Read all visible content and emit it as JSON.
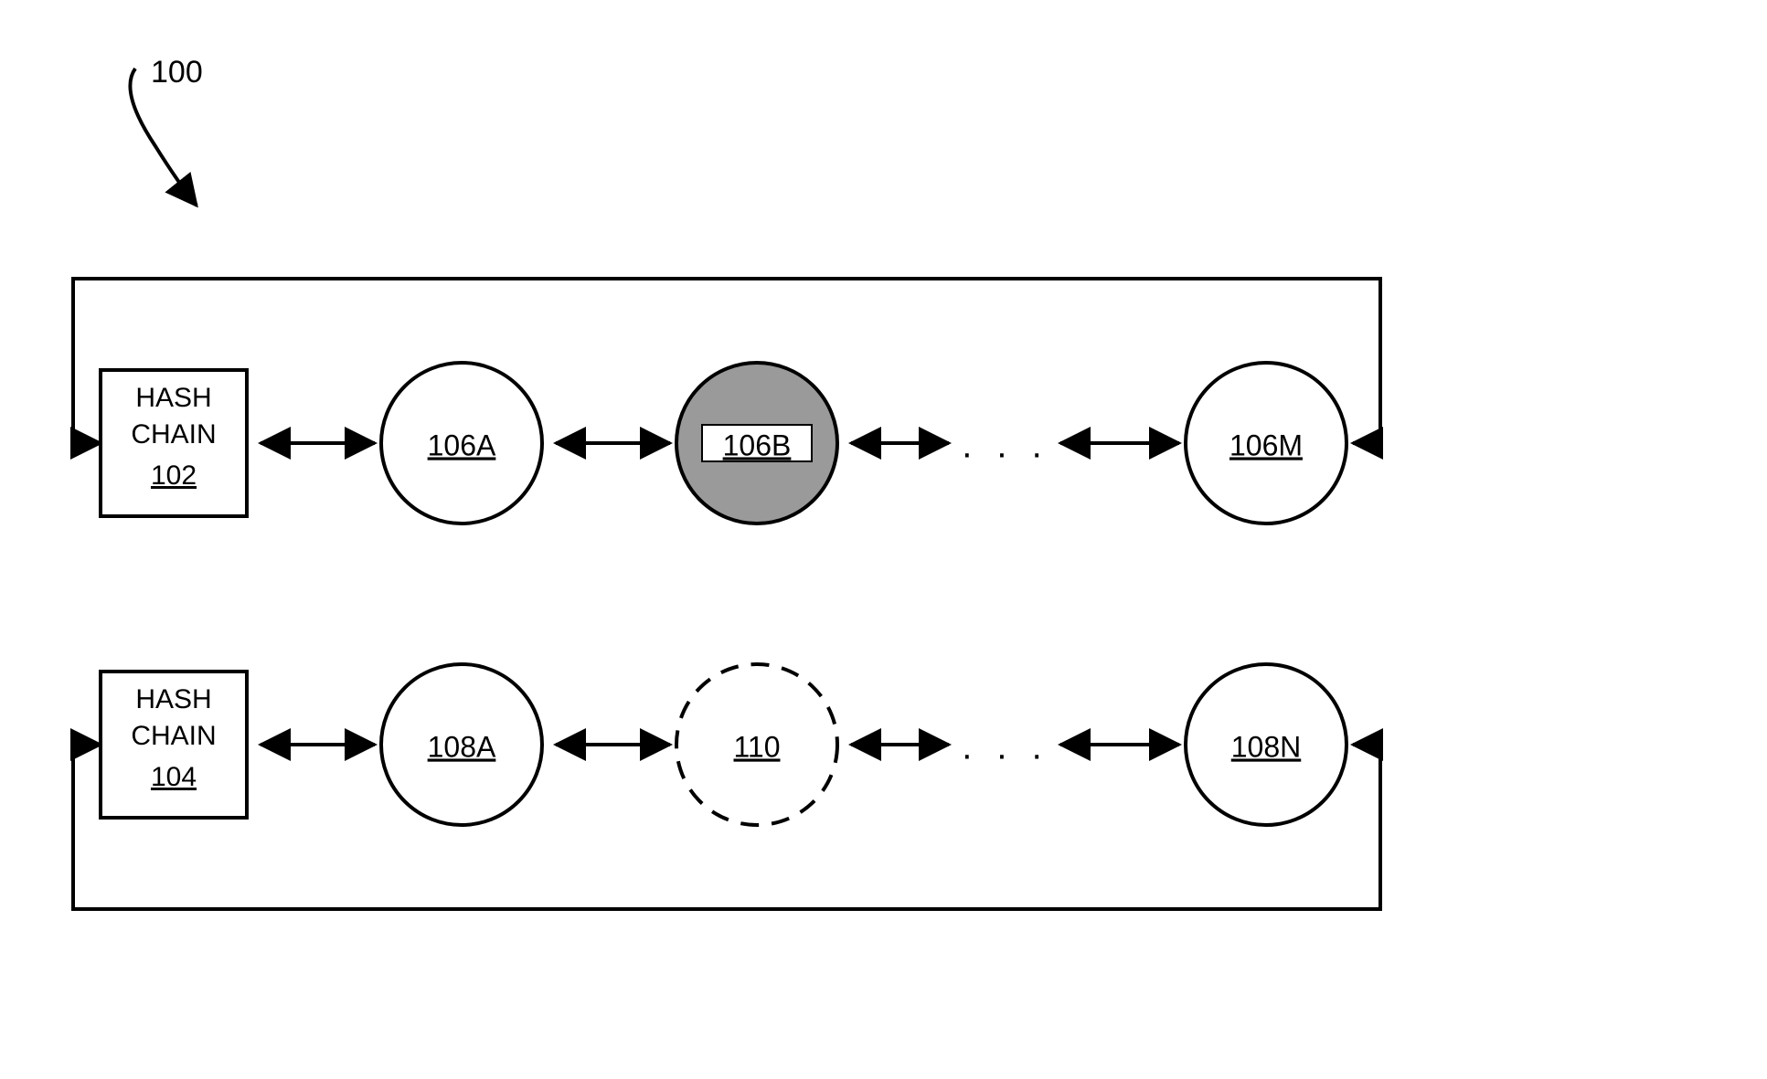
{
  "figure_ref": "100",
  "row1": {
    "box": {
      "line1": "HASH",
      "line2": "CHAIN",
      "ref": "102"
    },
    "nodes": [
      "106A",
      "106B",
      "106M"
    ],
    "ellipsis": ". . ."
  },
  "row2": {
    "box": {
      "line1": "HASH",
      "line2": "CHAIN",
      "ref": "104"
    },
    "nodes": [
      "108A",
      "110",
      "108N"
    ],
    "ellipsis": ". . ."
  }
}
